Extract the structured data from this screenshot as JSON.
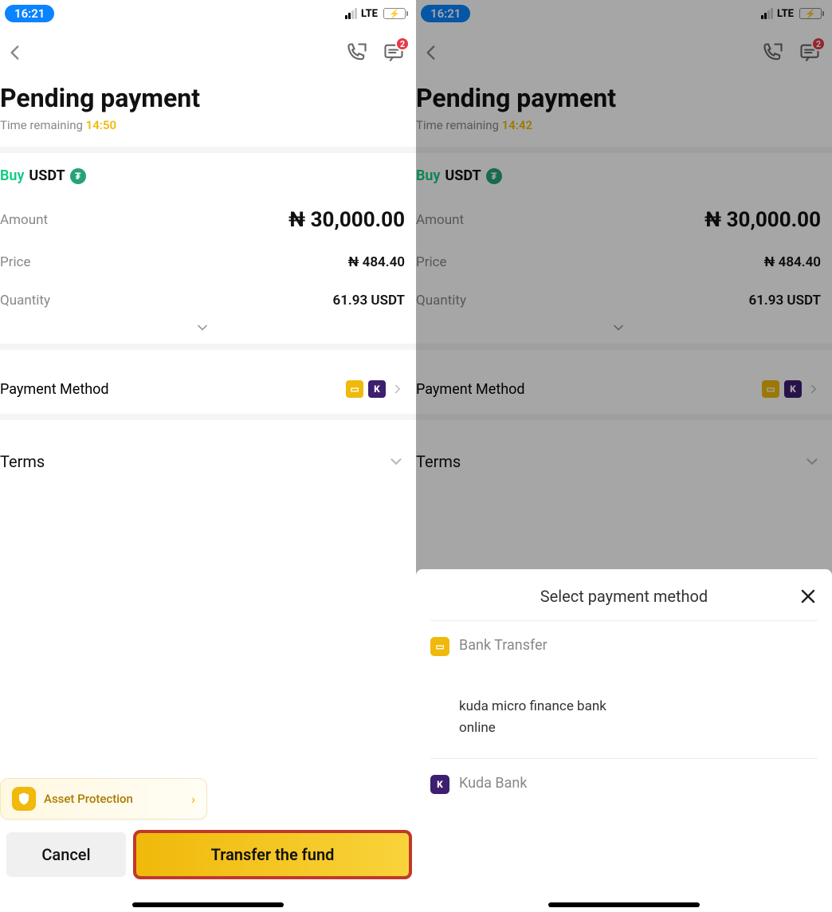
{
  "status": {
    "time": "16:21",
    "net": "LTE"
  },
  "nav": {
    "badge": "2"
  },
  "page": {
    "title": "Pending payment",
    "time_remaining_label": "Time remaining",
    "time_remaining_left": "14:50",
    "time_remaining_right": "14:42"
  },
  "order": {
    "buy_label": "Buy",
    "asset": "USDT",
    "asset_badge": "₮",
    "amount_label": "Amount",
    "amount_value": "₦ 30,000.00",
    "price_label": "Price",
    "price_value": "₦ 484.40",
    "qty_label": "Quantity",
    "qty_value": "61.93 USDT"
  },
  "pm": {
    "label": "Payment Method"
  },
  "terms": {
    "label": "Terms"
  },
  "asset_protection": {
    "label": "Asset Protection"
  },
  "buttons": {
    "cancel": "Cancel",
    "transfer": "Transfer the fund"
  },
  "modal": {
    "title": "Select payment method",
    "bank_transfer": "Bank Transfer",
    "detail_line1": "kuda micro finance bank",
    "detail_line2": "online",
    "kuda": "Kuda Bank"
  }
}
